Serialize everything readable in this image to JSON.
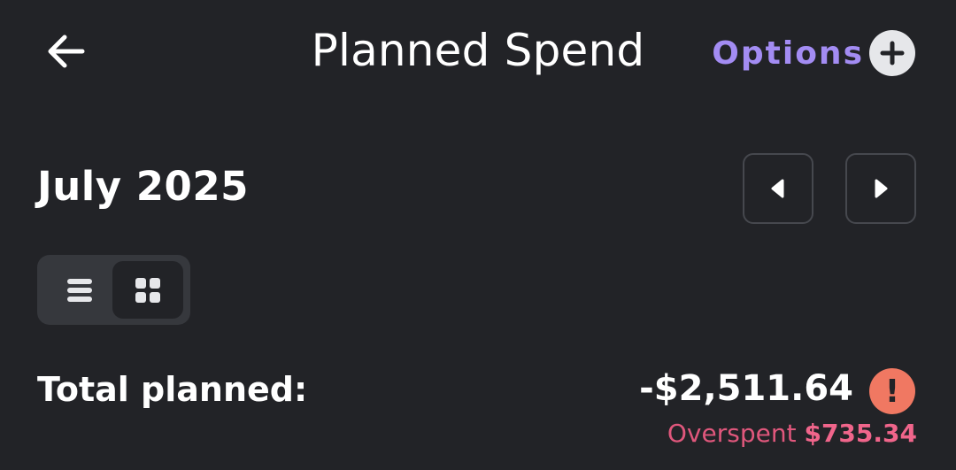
{
  "header": {
    "title": "Planned Spend",
    "back_icon": "arrow-left-icon",
    "options_label": "Options",
    "options_icon": "plus-circle-icon"
  },
  "period": {
    "month_label": "July 2025",
    "prev_icon": "caret-left-icon",
    "next_icon": "caret-right-icon"
  },
  "view_toggle": {
    "options": [
      "list",
      "grid"
    ],
    "selected": "grid"
  },
  "summary": {
    "total_label": "Total planned:",
    "total_amount": "-$2,511.64",
    "alert_symbol": "!",
    "overspent_label": "Overspent",
    "overspent_amount": "$735.34"
  },
  "colors": {
    "background": "#222327",
    "accent": "#a38cf3",
    "alert": "#f07862",
    "overspent": "#f0658b"
  }
}
